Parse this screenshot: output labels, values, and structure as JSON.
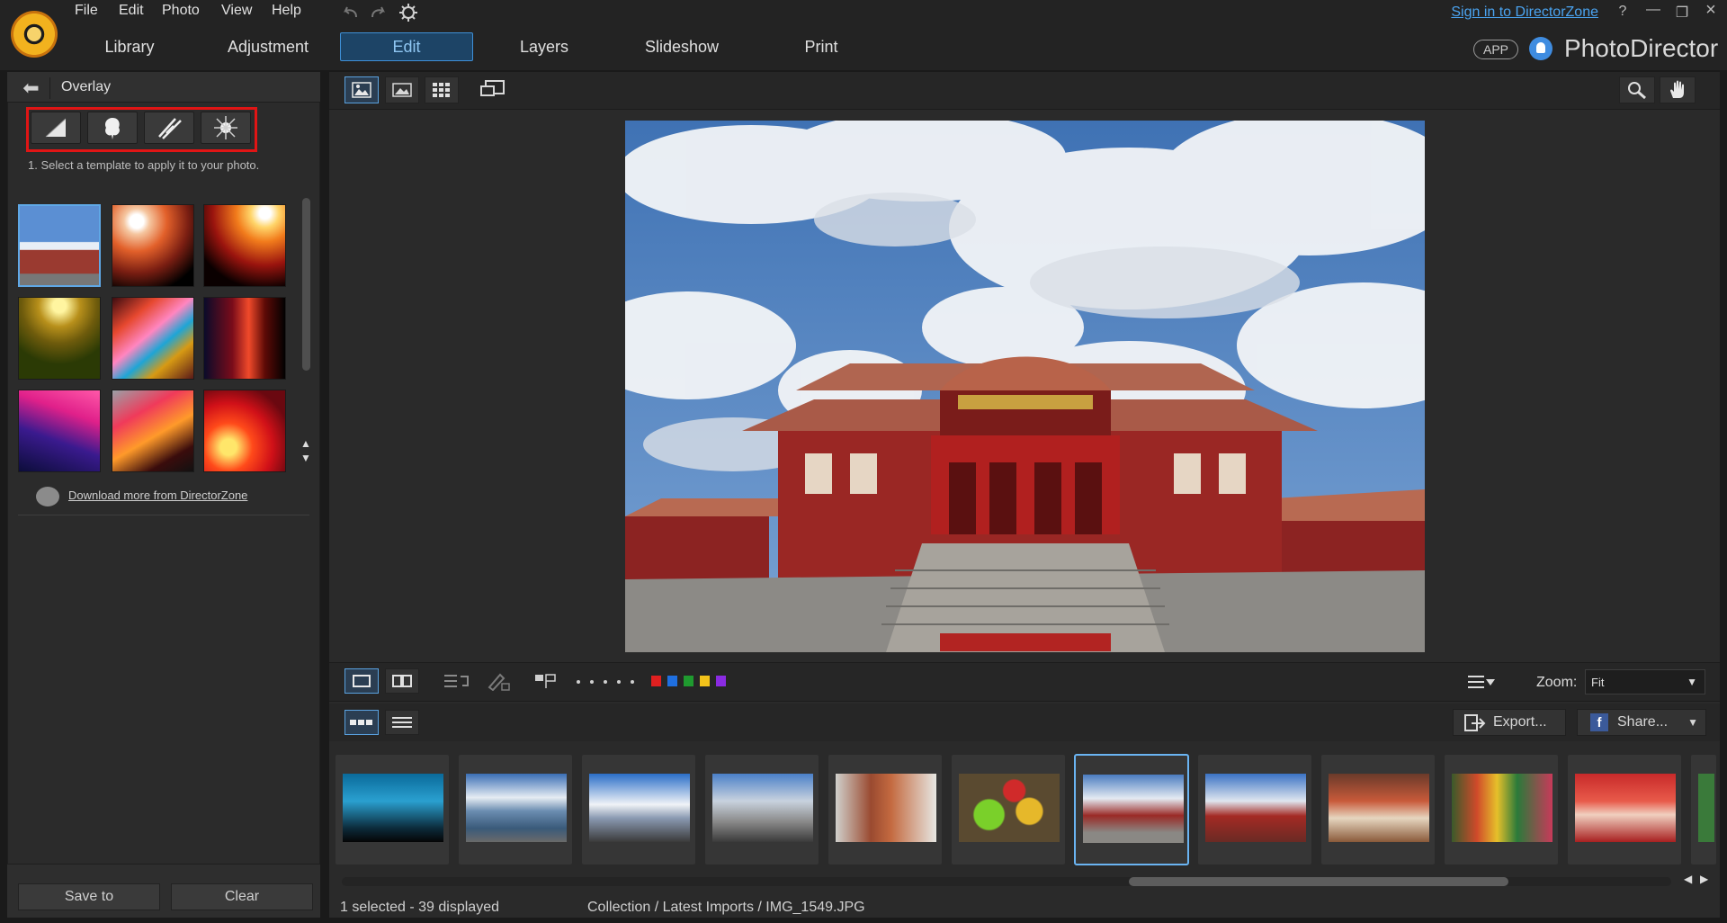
{
  "menu": [
    "File",
    "Edit",
    "Photo",
    "View",
    "Help"
  ],
  "tabs": [
    "Library",
    "Adjustment",
    "Edit",
    "Layers",
    "Slideshow",
    "Print"
  ],
  "active_tab": "Edit",
  "header": {
    "signin": "Sign in to DirectorZone",
    "help": "?",
    "app_badge": "APP",
    "brand": "PhotoDirector"
  },
  "panel": {
    "back_icon": "back-arrow-icon",
    "title": "Overlay",
    "categories": [
      "light-leak-icon",
      "bokeh-icon",
      "streak-icon",
      "flare-icon"
    ],
    "hint": "1. Select a template to apply it to your photo.",
    "download_link": "Download more from DirectorZone",
    "save_label": "Save to",
    "clear_label": "Clear"
  },
  "toolbar": {
    "view_modes": [
      "compare-view-icon",
      "single-view-icon",
      "grid-view-icon",
      "fullscreen-icon"
    ],
    "zoom_label": "Zoom:",
    "zoom_value": "Fit",
    "color_labels": [
      "#e02020",
      "#1f6fe0",
      "#1f9a2f",
      "#f2c21a",
      "#8a2be2"
    ]
  },
  "actions": {
    "export_label": "Export...",
    "share_label": "Share..."
  },
  "status": {
    "selected": "1 selected - 39 displayed",
    "path": "Collection / Latest Imports / IMG_1549.JPG"
  }
}
